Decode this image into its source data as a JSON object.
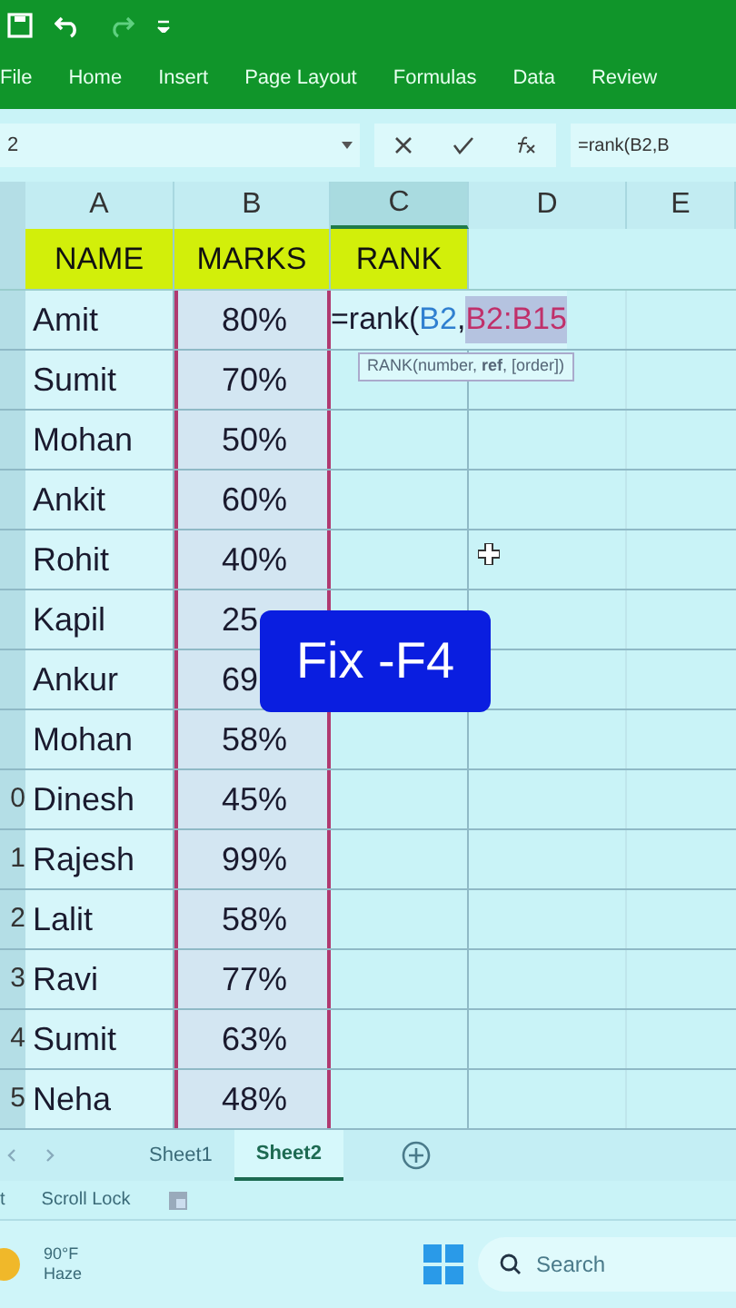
{
  "ribbon": {
    "tabs": [
      {
        "label": "File",
        "selected": false
      },
      {
        "label": "Home",
        "selected": false
      },
      {
        "label": "Insert",
        "selected": false
      },
      {
        "label": "Page Layout",
        "selected": false
      },
      {
        "label": "Formulas",
        "selected": false
      },
      {
        "label": "Data",
        "selected": false
      },
      {
        "label": "Review",
        "selected": false
      }
    ]
  },
  "formula_bar": {
    "name_box": "2",
    "formula": "=rank(B2,B"
  },
  "columns": [
    {
      "label": "A",
      "selected": false
    },
    {
      "label": "B",
      "selected": false
    },
    {
      "label": "C",
      "selected": true
    },
    {
      "label": "D",
      "selected": false
    },
    {
      "label": "E",
      "selected": false
    }
  ],
  "header_row": [
    "NAME",
    "MARKS",
    "RANK"
  ],
  "rows": [
    {
      "num": "",
      "name": "Amit",
      "marks": "80%"
    },
    {
      "num": "",
      "name": "Sumit",
      "marks": "70%"
    },
    {
      "num": "",
      "name": "Mohan",
      "marks": "50%"
    },
    {
      "num": "",
      "name": "Ankit",
      "marks": "60%"
    },
    {
      "num": "",
      "name": "Rohit",
      "marks": "40%"
    },
    {
      "num": "",
      "name": "Kapil",
      "marks": "25"
    },
    {
      "num": "",
      "name": "Ankur",
      "marks": "69"
    },
    {
      "num": "",
      "name": "Mohan",
      "marks": "58%"
    },
    {
      "num": "0",
      "name": "Dinesh",
      "marks": "45%"
    },
    {
      "num": "1",
      "name": "Rajesh",
      "marks": "99%"
    },
    {
      "num": "2",
      "name": "Lalit",
      "marks": "58%"
    },
    {
      "num": "3",
      "name": "Ravi",
      "marks": "77%"
    },
    {
      "num": "4",
      "name": "Sumit",
      "marks": "63%"
    },
    {
      "num": "5",
      "name": "Neha",
      "marks": "48%"
    }
  ],
  "editing_cell": {
    "parts": [
      {
        "text": "=rank(",
        "color": "#1a1a2e"
      },
      {
        "text": "B2",
        "color": "#2f7fd0"
      },
      {
        "text": ",",
        "color": "#1a1a2e"
      },
      {
        "text": "B2:B15",
        "color": "#c0306a"
      }
    ],
    "tooltip": "RANK(number, **ref**, [order])"
  },
  "caption": "Fix -F4",
  "sheet_tabs": [
    {
      "label": "Sheet1",
      "selected": false
    },
    {
      "label": "Sheet2",
      "selected": true
    }
  ],
  "status_bar": [
    "t",
    "Scroll Lock"
  ],
  "taskbar": {
    "temperature": "90°F",
    "weather": "Haze",
    "search": "Search"
  }
}
